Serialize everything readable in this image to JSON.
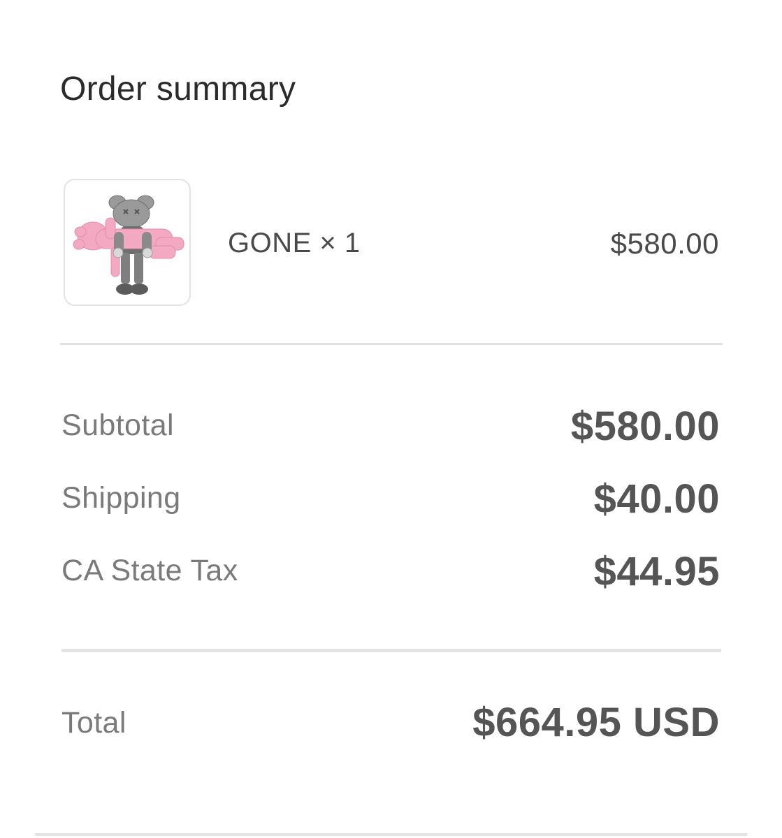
{
  "header": {
    "title": "Order summary"
  },
  "item": {
    "image_icon": "kaws-gone-figure-image",
    "name": "GONE × 1",
    "price": "$580.00"
  },
  "totals": {
    "subtotal_label": "Subtotal",
    "subtotal_value": "$580.00",
    "shipping_label": "Shipping",
    "shipping_value": "$40.00",
    "tax_label": "CA State Tax",
    "tax_value": "$44.95",
    "total_label": "Total",
    "total_value": "$664.95 USD"
  },
  "colors": {
    "background": "#ffffff",
    "text_primary": "#2b2b2b",
    "text_label": "#7a7a7a",
    "text_amount": "#555555",
    "divider": "#e0e0e0",
    "figure_grey": "#8c8c8c",
    "figure_pink": "#f4a9c2"
  }
}
